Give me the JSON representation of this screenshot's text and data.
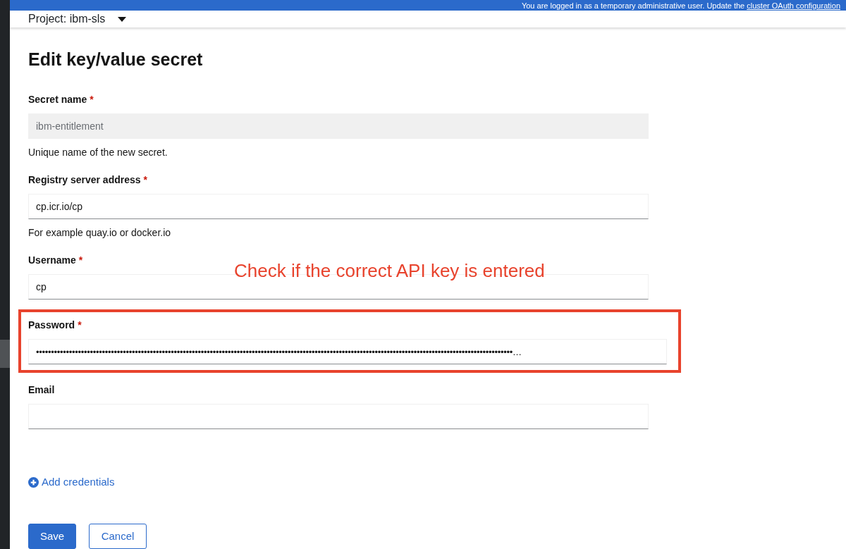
{
  "banner": {
    "text": "You are logged in as a temporary administrative user. Update the ",
    "link": "cluster OAuth configuration"
  },
  "project": {
    "label": "Project: ibm-sls"
  },
  "title": "Edit key/value secret",
  "fields": [
    {
      "label": "Secret name",
      "required_mark": "*",
      "value": "ibm-entitlement",
      "disabled": true,
      "helper": "Unique name of the new secret.",
      "highlighted": false
    },
    {
      "label": "Registry server address",
      "required_mark": "*",
      "value": "cp.icr.io/cp",
      "disabled": false,
      "helper": "For example quay.io or docker.io",
      "highlighted": false
    },
    {
      "label": "Username",
      "required_mark": "*",
      "value": "cp",
      "disabled": false,
      "highlighted": false
    },
    {
      "label": "Password",
      "required_mark": "*",
      "value": "•••••••••••••••••••••••••••••••••••••••••••••••••••••••••••••••••••••••••••••••••••••••••••••••••••••••••••••••••••••••••••••••••••••••••••••••••••••••••••••••…",
      "disabled": false,
      "highlighted": true
    },
    {
      "label": "Email",
      "disabled": false,
      "highlighted": false
    }
  ],
  "annotation": {
    "text": "Check if the correct API key is entered"
  },
  "add_link": "Add credentials",
  "buttons": [
    {
      "label": "Save",
      "kind": "primary"
    },
    {
      "label": "Cancel",
      "kind": "secondary"
    }
  ]
}
